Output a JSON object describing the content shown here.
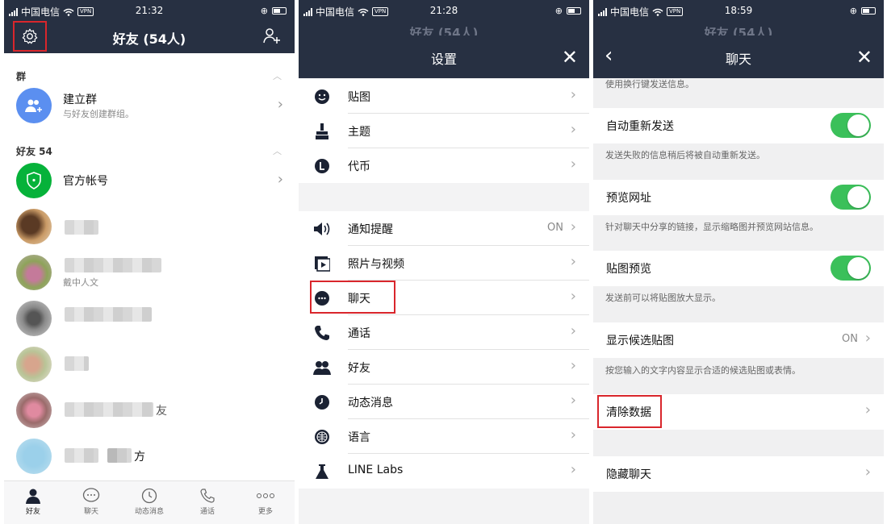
{
  "panel1": {
    "status": {
      "carrier": "中国电信",
      "vpn": "VPN",
      "time": "21:32"
    },
    "header": {
      "title": "好友 (54人)"
    },
    "group_section": {
      "title": "群"
    },
    "create_group": {
      "name": "建立群",
      "sub": "与好友创建群组。"
    },
    "friends_section": {
      "title": "好友 54"
    },
    "official": {
      "name": "官方帐号"
    },
    "friend_rows": [
      {
        "visible_text": ""
      },
      {
        "visible_text": "戴中人文"
      },
      {
        "visible_text": ""
      },
      {
        "visible_text": ""
      },
      {
        "visible_text": "友"
      },
      {
        "visible_text": "方"
      }
    ],
    "tabs": [
      {
        "label": "好友",
        "icon": "person-icon",
        "active": true
      },
      {
        "label": "聊天",
        "icon": "chat-bubble-icon"
      },
      {
        "label": "动态消息",
        "icon": "clock-icon"
      },
      {
        "label": "通话",
        "icon": "phone-icon"
      },
      {
        "label": "更多",
        "icon": "more-dots-icon"
      }
    ]
  },
  "panel2": {
    "status": {
      "carrier": "中国电信",
      "vpn": "VPN",
      "time": "21:28"
    },
    "behind_title": "好友 (54人)",
    "header": {
      "title": "设置",
      "close": "✕"
    },
    "group1": [
      {
        "label": "贴图",
        "icon": "smiley-icon"
      },
      {
        "label": "主题",
        "icon": "brush-icon"
      },
      {
        "label": "代币",
        "icon": "coin-icon"
      }
    ],
    "group2": [
      {
        "label": "通知提醒",
        "value": "ON",
        "icon": "speaker-icon"
      },
      {
        "label": "照片与视频",
        "icon": "video-icon"
      },
      {
        "label": "聊天",
        "icon": "chat-icon"
      },
      {
        "label": "通话",
        "icon": "phone-icon"
      },
      {
        "label": "好友",
        "icon": "friends-icon"
      },
      {
        "label": "动态消息",
        "icon": "clock-icon"
      },
      {
        "label": "语言",
        "icon": "globe-icon"
      },
      {
        "label": "LINE Labs",
        "icon": "flask-icon"
      }
    ]
  },
  "panel3": {
    "status": {
      "carrier": "中国电信",
      "vpn": "VPN",
      "time": "18:59"
    },
    "behind_title": "好友 (54人)",
    "header": {
      "title": "聊天",
      "back": "‹",
      "close": "✕"
    },
    "top_desc": "使用换行键发送信息。",
    "items": [
      {
        "label": "自动重新发送",
        "desc": "发送失败的信息稍后将被自动重新发送。",
        "toggle": true
      },
      {
        "label": "预览网址",
        "desc": "针对聊天中分享的链接，显示缩略图并预览网站信息。",
        "toggle": true
      },
      {
        "label": "贴图预览",
        "desc": "发送前可以将贴图放大显示。",
        "toggle": true
      },
      {
        "label": "显示候选贴图",
        "value": "ON",
        "desc": "按您输入的文字内容显示合适的候选贴图或表情。"
      }
    ],
    "clear_data": "清除数据",
    "hidden_chats": "隐藏聊天"
  },
  "colors": {
    "header": "#273042",
    "highlight": "#d9262c",
    "toggle_on": "#3bc05a",
    "official_green": "#06b23a",
    "group_blue": "#5b8ff0"
  }
}
